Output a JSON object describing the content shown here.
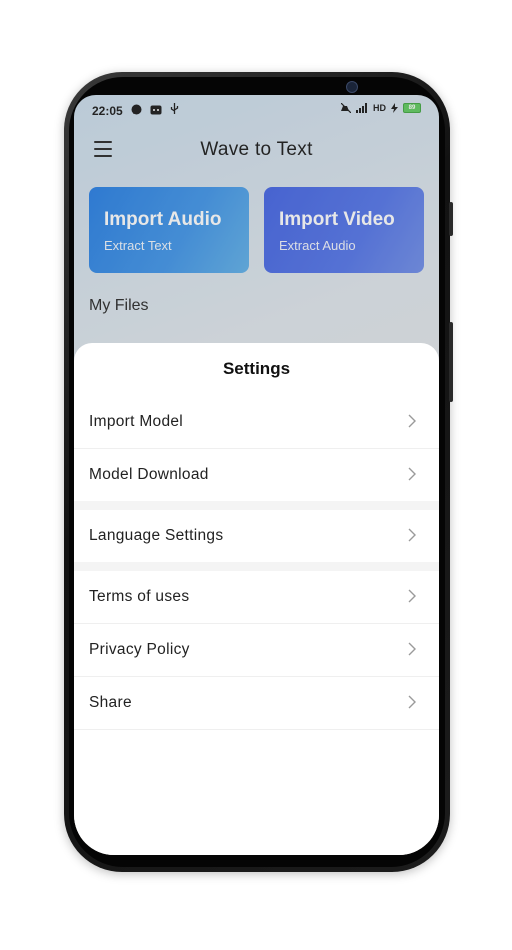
{
  "status_bar": {
    "time": "22:05",
    "network": "HD",
    "battery": "89"
  },
  "header": {
    "title": "Wave to Text"
  },
  "cards": {
    "audio": {
      "title": "Import Audio",
      "subtitle": "Extract Text"
    },
    "video": {
      "title": "Import Video",
      "subtitle": "Extract Audio"
    }
  },
  "section": {
    "my_files": "My Files"
  },
  "settings": {
    "title": "Settings",
    "items": [
      {
        "label": "Import Model"
      },
      {
        "label": "Model Download"
      },
      {
        "label": "Language Settings"
      },
      {
        "label": "Terms of uses"
      },
      {
        "label": "Privacy Policy"
      },
      {
        "label": "Share"
      }
    ]
  },
  "icons": {
    "menu": "hamburger-menu-icon",
    "chevron": "chevron-right-icon"
  },
  "colors": {
    "audio_card": "#1f7ae4",
    "video_card": "#3d5fe3",
    "battery": "#5ac85a"
  }
}
